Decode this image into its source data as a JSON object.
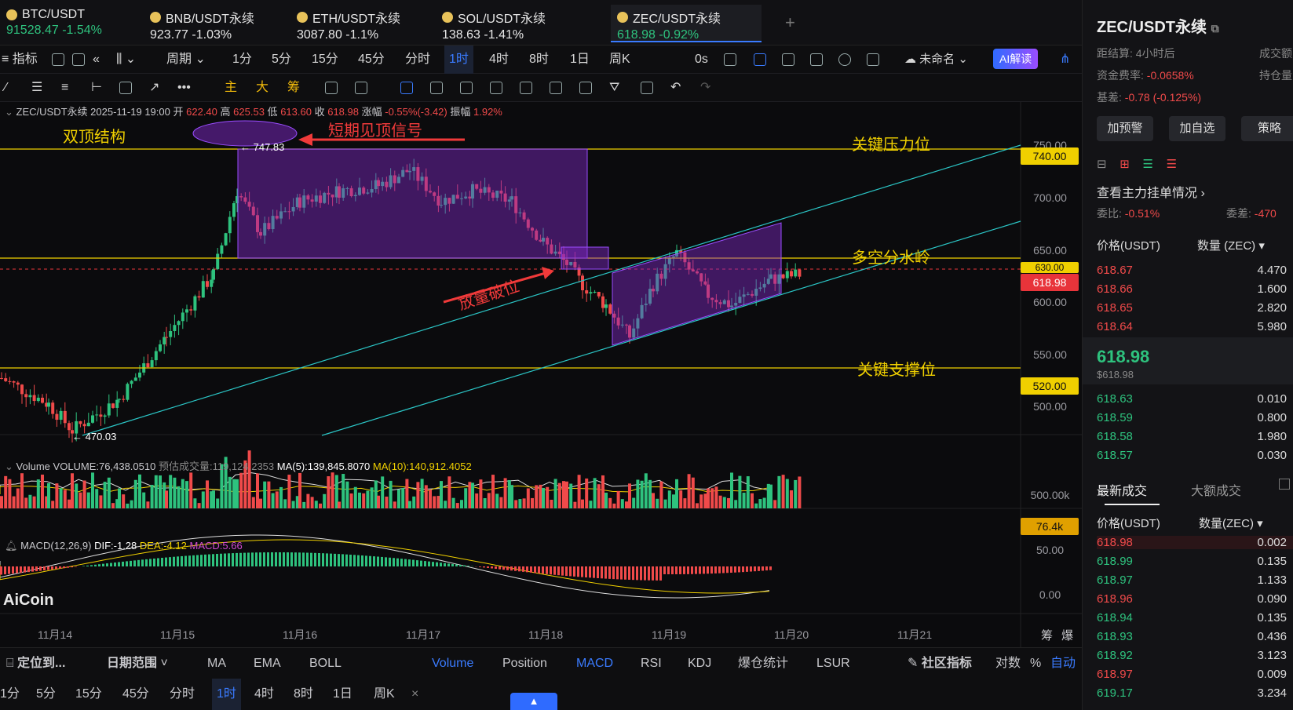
{
  "tickers": [
    {
      "name": "BTC/USDT",
      "price": "91528.47",
      "change": "-1.54%"
    },
    {
      "name": "BNB/USDT永续",
      "price": "923.77",
      "change": "-1.03%"
    },
    {
      "name": "ETH/USDT永续",
      "price": "3087.80",
      "change": "-1.1%"
    },
    {
      "name": "SOL/USDT永续",
      "price": "138.63",
      "change": "-1.41%"
    },
    {
      "name": "ZEC/USDT永续",
      "price": "618.98",
      "change": "-0.92%"
    }
  ],
  "toolbar1": {
    "indicators": "指标",
    "period": "周期",
    "intervals": [
      "1分",
      "5分",
      "15分",
      "45分",
      "分时",
      "1时",
      "4时",
      "8时",
      "1日",
      "周K"
    ],
    "active_interval": "1时",
    "timer": "0s",
    "unnamed": "未命名",
    "ai": "AI解读"
  },
  "toolbar2": {
    "labels": [
      "主",
      "大",
      "筹"
    ]
  },
  "infoline": {
    "symbol": "ZEC/USDT永续",
    "datetime": "2025-11-19 19:00",
    "open_l": "开",
    "open": "622.40",
    "high_l": "高",
    "high": "625.53",
    "low_l": "低",
    "low": "613.60",
    "close_l": "收",
    "close": "618.98",
    "chg_l": "涨幅",
    "chg": "-0.55%(-3.42)",
    "amp_l": "振幅",
    "amp": "1.92%"
  },
  "annotations": {
    "double_top": "双顶结构",
    "top_signal": "短期见顶信号",
    "resistance": "关键压力位",
    "watershed": "多空分水岭",
    "breakdown": "放量破位",
    "support": "关键支撑位",
    "high_mark": "747.83",
    "low_mark": "470.03"
  },
  "price_axis": {
    "ticks": [
      "750.00",
      "700.00",
      "650.00",
      "600.00",
      "550.00",
      "500.00"
    ],
    "tags": {
      "resistance": "740.00",
      "watershed": "630.00",
      "current": "618.98",
      "support": "520.00"
    }
  },
  "volume": {
    "title": "Volume",
    "vol": "VOLUME:76,438.0510",
    "est": "预估成交量:119,124.2353",
    "ma5": "MA(5):139,845.8070",
    "ma10": "MA(10):140,912.4052",
    "axis": "500.00k",
    "tag": "76.4k"
  },
  "macd": {
    "title": "MACD(12,26,9)",
    "dif": "DIF:-1.28",
    "dea": "DEA:-4.12",
    "macd": "MACD:5.66",
    "axis": [
      "50.00",
      "0.00"
    ]
  },
  "watermark": "AiCoin",
  "time_axis": [
    "11月14",
    "11月15",
    "11月16",
    "11月17",
    "11月18",
    "11月19",
    "11月20",
    "11月21"
  ],
  "axis_corner": [
    "筹",
    "爆"
  ],
  "bottom1": {
    "locate": "定位到...",
    "range": "日期范围",
    "items": [
      "MA",
      "EMA",
      "BOLL",
      "Volume",
      "Position",
      "MACD",
      "RSI",
      "KDJ",
      "爆仓统计",
      "LSUR"
    ],
    "community": "社区指标",
    "log": "对数",
    "pct": "%",
    "auto": "自动"
  },
  "bottom2": {
    "intervals": [
      "1分",
      "5分",
      "15分",
      "45分",
      "分时",
      "1时",
      "4时",
      "8时",
      "1日",
      "周K"
    ],
    "active": "1时",
    "close": "×"
  },
  "right": {
    "title": "ZEC/USDT永续",
    "settle": "距结算:",
    "settle_v": "4小时后",
    "turnover": "成交额",
    "funding": "资金费率:",
    "funding_v": "-0.0658%",
    "oi": "持仓量",
    "basis": "基差:",
    "basis_v": "-0.78 (-0.125%)",
    "buttons": [
      "加预警",
      "加自选",
      "策略"
    ],
    "orderbook_link": "查看主力挂单情况",
    "ratio": "委比:",
    "ratio_v": "-0.51%",
    "diff": "委差:",
    "diff_v": "-470",
    "col_price": "价格(USDT)",
    "col_qty": "数量 (ZEC)",
    "asks": [
      [
        "618.67",
        "4.470"
      ],
      [
        "618.66",
        "1.600"
      ],
      [
        "618.65",
        "2.820"
      ],
      [
        "618.64",
        "5.980"
      ]
    ],
    "last": "618.98",
    "last_usd": "$618.98",
    "bids": [
      [
        "618.63",
        "0.010"
      ],
      [
        "618.59",
        "0.800"
      ],
      [
        "618.58",
        "1.980"
      ],
      [
        "618.57",
        "0.030"
      ]
    ],
    "tab_latest": "最新成交",
    "tab_large": "大额成交",
    "col_price2": "价格(USDT)",
    "col_qty2": "数量(ZEC)",
    "trades": [
      [
        "618.98",
        "0.002",
        "r"
      ],
      [
        "618.99",
        "0.135",
        "g"
      ],
      [
        "618.97",
        "1.133",
        "g"
      ],
      [
        "618.96",
        "0.090",
        "r"
      ],
      [
        "618.94",
        "0.135",
        "g"
      ],
      [
        "618.93",
        "0.436",
        "g"
      ],
      [
        "618.92",
        "3.123",
        "g"
      ],
      [
        "618.97",
        "0.009",
        "r"
      ],
      [
        "619.17",
        "3.234",
        "g"
      ]
    ]
  }
}
